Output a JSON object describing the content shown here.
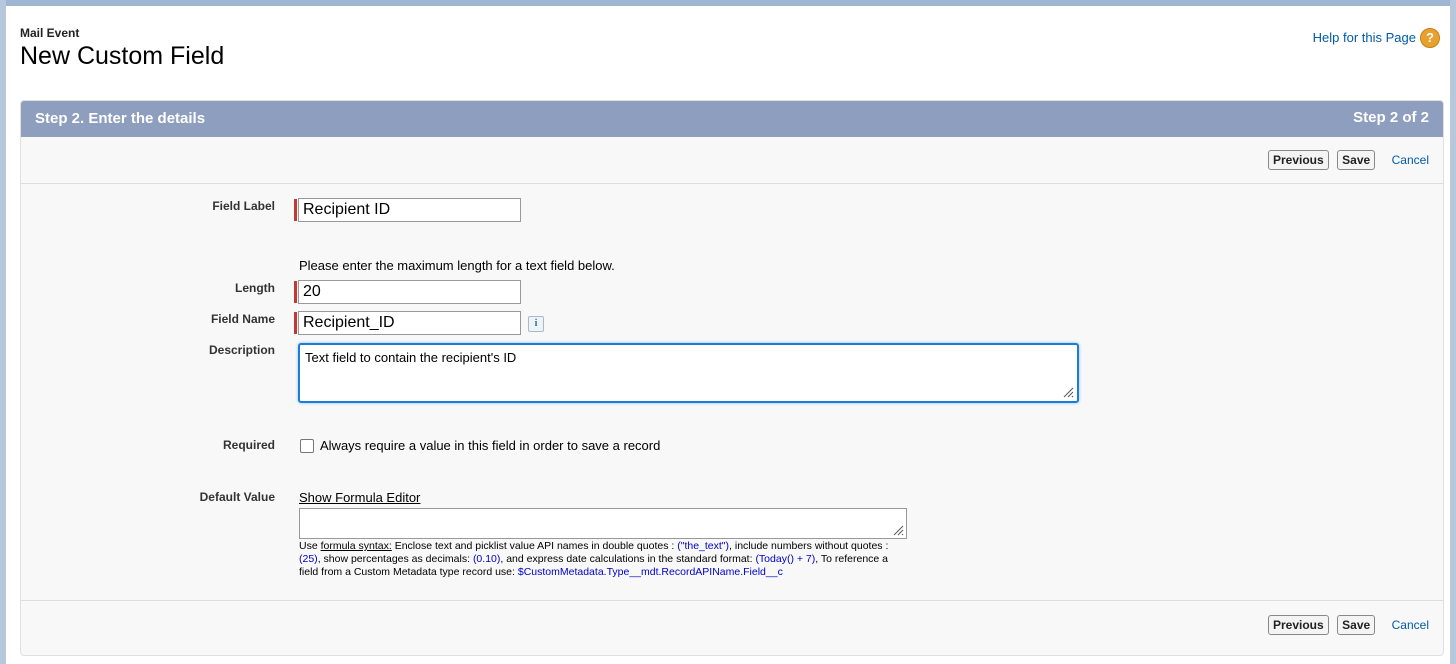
{
  "header": {
    "object_name": "Mail Event",
    "page_title": "New Custom Field",
    "help_link": "Help for this Page",
    "help_icon": "question-icon"
  },
  "step_bar": {
    "title": "Step 2. Enter the details",
    "count": "Step 2 of 2"
  },
  "buttons": {
    "previous": "Previous",
    "save": "Save",
    "cancel": "Cancel"
  },
  "fields": {
    "field_label": {
      "label": "Field Label",
      "value": "Recipient ID"
    },
    "length_hint": "Please enter the maximum length for a text field below.",
    "length": {
      "label": "Length",
      "value": "20"
    },
    "field_name": {
      "label": "Field Name",
      "value": "Recipient_ID",
      "info_icon": "i"
    },
    "description": {
      "label": "Description",
      "value": "Text field to contain the recipient's ID"
    },
    "required": {
      "label": "Required",
      "checkbox_text": "Always require a value in this field in order to save a record",
      "checked": false
    },
    "default_value": {
      "label": "Default Value",
      "formula_link": "Show Formula Editor",
      "value": ""
    }
  },
  "formula_help": {
    "use": "Use ",
    "formula_syntax": "formula syntax:",
    "t1": " Enclose text and picklist value API names in double quotes : ",
    "e1": "(\"the_text\")",
    "t2": ", include numbers without quotes : ",
    "e2": "(25)",
    "t3": ", show percentages as decimals: ",
    "e3": "(0.10)",
    "t4": ", and express date calculations in the standard format: ",
    "e4": "(Today() + 7)",
    "t5": ", To reference a field from a Custom Metadata type record use: ",
    "e5": "$CustomMetadata.Type__mdt.RecordAPIName.Field__c"
  },
  "colors": {
    "step_bar": "#8d9ebf",
    "required_marker": "#c23934",
    "link_blue": "#015ba7",
    "focus_blue": "#1b7dd6"
  }
}
